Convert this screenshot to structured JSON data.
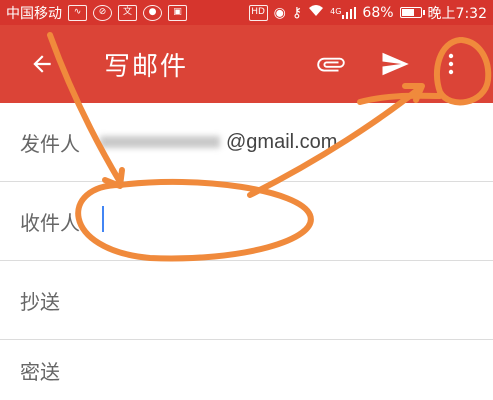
{
  "status_bar": {
    "carrier": "中国移动",
    "hd": "HD",
    "signal_label": "4G",
    "battery": "68%",
    "battery_level": 0.68,
    "time": "晚上7:32"
  },
  "app_bar": {
    "title": "写邮件",
    "color": "#db4437"
  },
  "fields": {
    "from_label": "发件人",
    "from_value": "@gmail.com",
    "to_label": "收件人",
    "cc_label": "抄送",
    "bcc_label": "密送"
  },
  "annotation_color": "#f08a3c"
}
